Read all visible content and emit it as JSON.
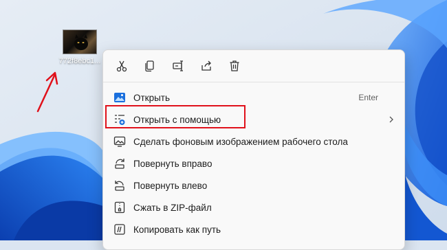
{
  "desktop": {
    "file_label": "772f8ebc1..."
  },
  "toolbar": {
    "cut_icon": "scissors-icon",
    "copy_icon": "copy-icon",
    "rename_icon": "rename-icon",
    "share_icon": "share-icon",
    "delete_icon": "trash-icon"
  },
  "menu": {
    "items": [
      {
        "label": "Открыть",
        "shortcut": "Enter",
        "icon": "photos-app-icon"
      },
      {
        "label": "Открыть с помощью",
        "icon": "open-with-icon"
      },
      {
        "label": "Сделать фоновым изображением рабочего стола",
        "icon": "set-wallpaper-icon"
      },
      {
        "label": "Повернуть вправо",
        "icon": "rotate-right-icon"
      },
      {
        "label": "Повернуть влево",
        "icon": "rotate-left-icon"
      },
      {
        "label": "Сжать в ZIP-файл",
        "icon": "zip-icon"
      },
      {
        "label": "Копировать как путь",
        "icon": "copy-path-icon"
      }
    ]
  },
  "colors": {
    "highlight_border": "#e0101a",
    "accent_blue": "#1a6fdd",
    "arrow_red": "#e0101a"
  }
}
